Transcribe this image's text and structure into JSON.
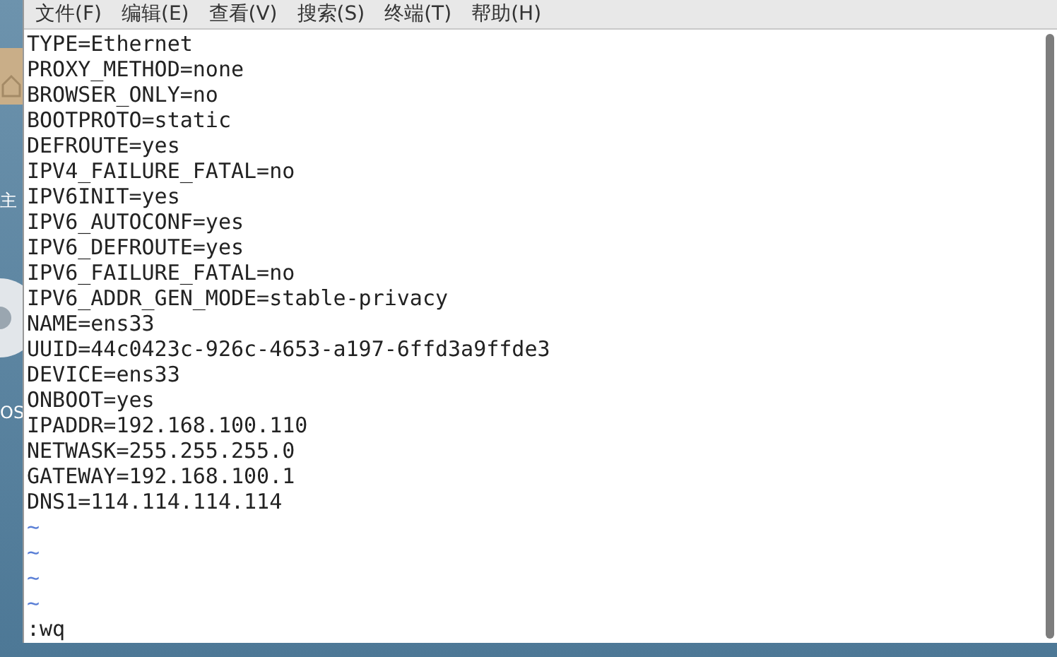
{
  "desktop_icons": [
    {
      "kind": "folder",
      "label": "主"
    },
    {
      "kind": "disc",
      "label": "OS"
    }
  ],
  "menu": [
    "文件(F)",
    "编辑(E)",
    "查看(V)",
    "搜索(S)",
    "终端(T)",
    "帮助(H)"
  ],
  "lines": [
    "TYPE=Ethernet",
    "PROXY_METHOD=none",
    "BROWSER_ONLY=no",
    "BOOTPROTO=static",
    "DEFROUTE=yes",
    "IPV4_FAILURE_FATAL=no",
    "IPV6INIT=yes",
    "IPV6_AUTOCONF=yes",
    "IPV6_DEFROUTE=yes",
    "IPV6_FAILURE_FATAL=no",
    "IPV6_ADDR_GEN_MODE=stable-privacy",
    "NAME=ens33",
    "UUID=44c0423c-926c-4653-a197-6ffd3a9ffde3",
    "DEVICE=ens33",
    "ONBOOT=yes",
    "IPADDR=192.168.100.110",
    "NETWASK=255.255.255.0",
    "GATEWAY=192.168.100.1",
    "DNS1=114.114.114.114"
  ],
  "empty_lines": [
    "~",
    "~",
    "~",
    "~"
  ],
  "command": ":wq"
}
